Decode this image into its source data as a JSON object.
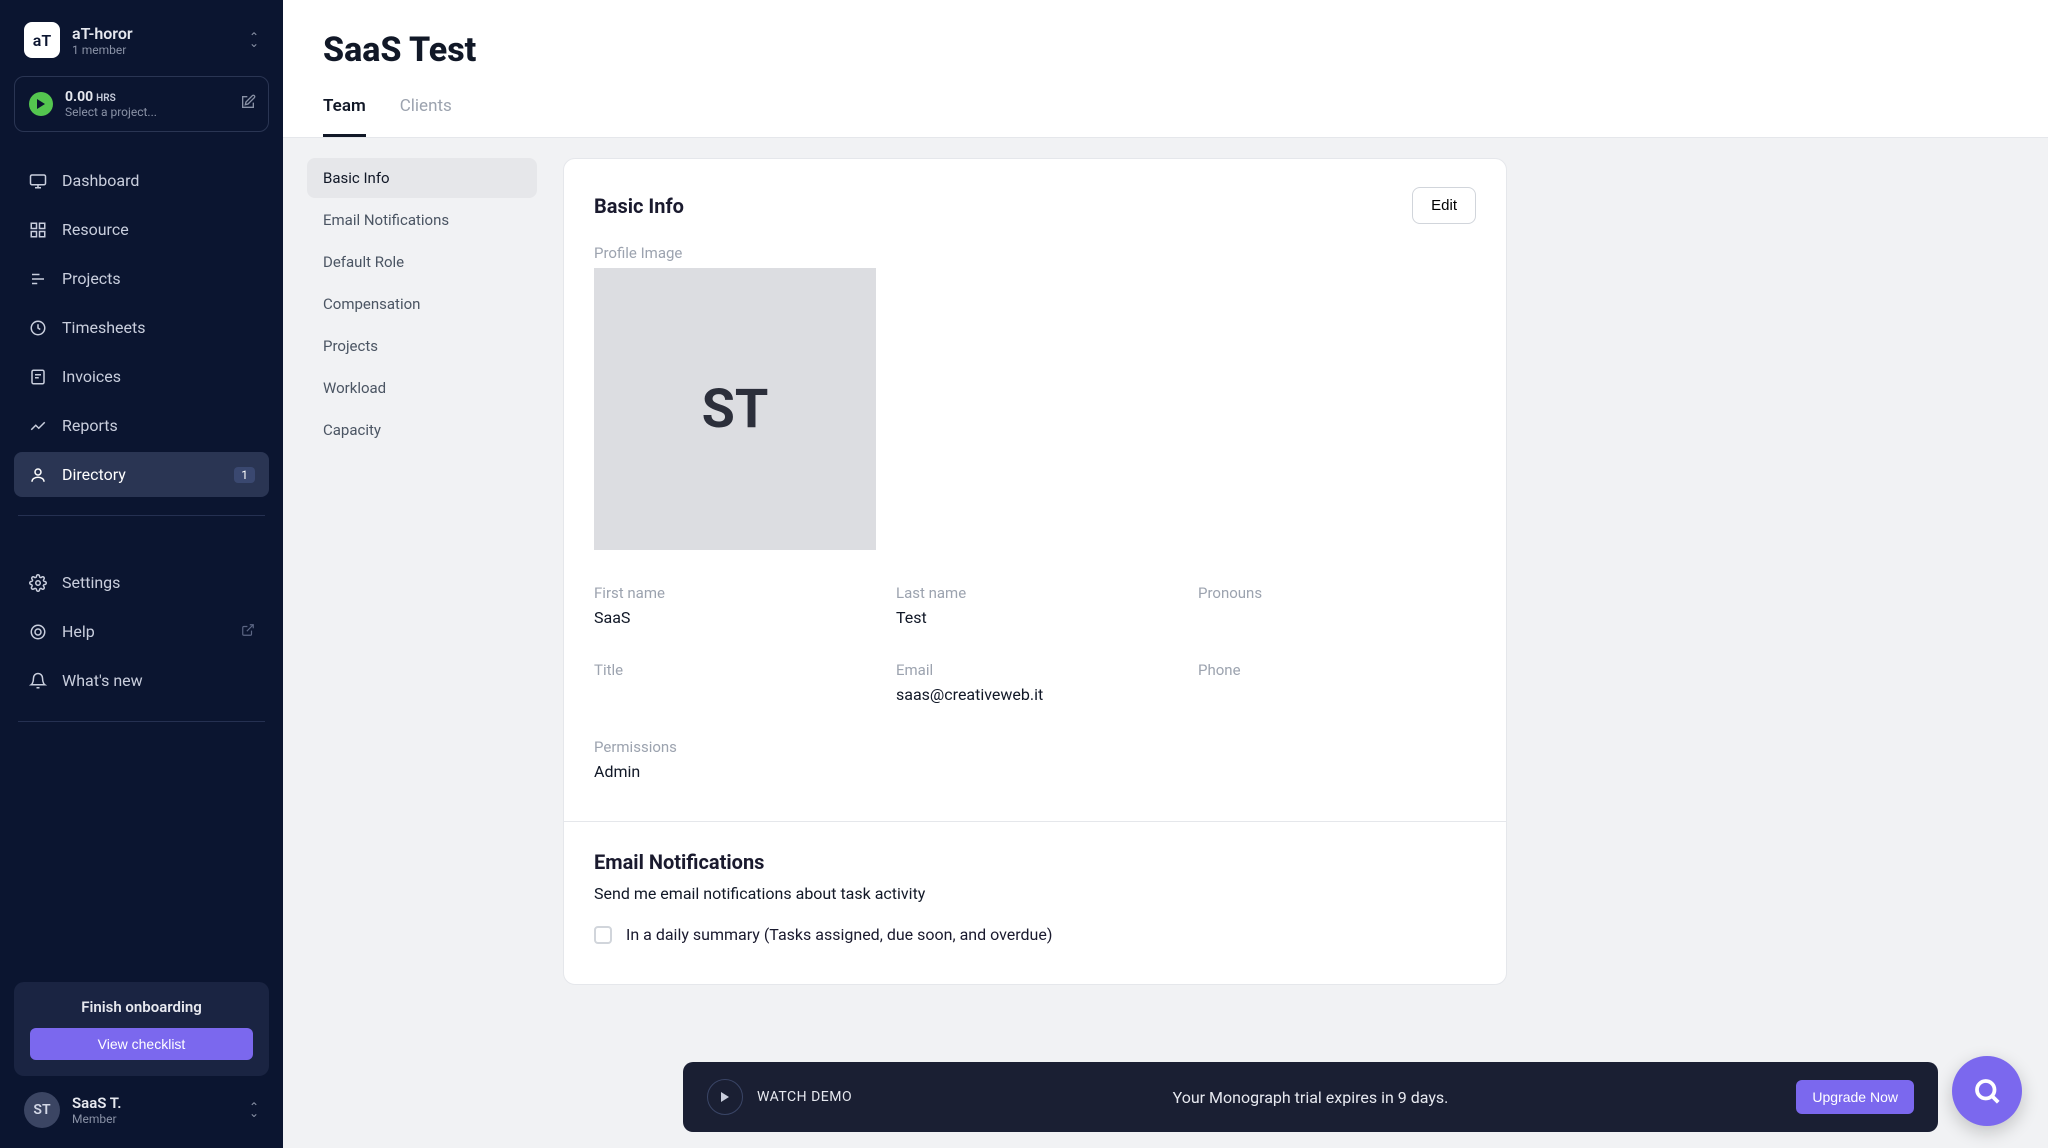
{
  "workspace": {
    "badge": "aT",
    "name": "aT-horor",
    "members": "1 member"
  },
  "timer": {
    "value": "0.00",
    "unit": "HRS",
    "subtitle": "Select a project..."
  },
  "nav": [
    {
      "label": "Dashboard"
    },
    {
      "label": "Resource"
    },
    {
      "label": "Projects"
    },
    {
      "label": "Timesheets"
    },
    {
      "label": "Invoices"
    },
    {
      "label": "Reports"
    },
    {
      "label": "Directory",
      "badge": "1",
      "active": true
    }
  ],
  "nav2": [
    {
      "label": "Settings"
    },
    {
      "label": "Help",
      "external": true
    },
    {
      "label": "What's new"
    }
  ],
  "onboarding": {
    "title": "Finish onboarding",
    "button": "View checklist"
  },
  "user": {
    "initials": "ST",
    "name": "SaaS T.",
    "role": "Member"
  },
  "header": {
    "title": "SaaS Test"
  },
  "tabs": [
    {
      "label": "Team",
      "active": true
    },
    {
      "label": "Clients"
    }
  ],
  "subnav": [
    {
      "label": "Basic Info",
      "active": true
    },
    {
      "label": "Email Notifications"
    },
    {
      "label": "Default Role"
    },
    {
      "label": "Compensation"
    },
    {
      "label": "Projects"
    },
    {
      "label": "Workload"
    },
    {
      "label": "Capacity"
    }
  ],
  "basic": {
    "section_title": "Basic Info",
    "edit": "Edit",
    "profile_label": "Profile Image",
    "profile_initials": "ST",
    "fields": {
      "first_label": "First name",
      "first_value": "SaaS",
      "last_label": "Last name",
      "last_value": "Test",
      "pronouns_label": "Pronouns",
      "pronouns_value": "",
      "title_label": "Title",
      "title_value": "",
      "email_label": "Email",
      "email_value": "saas@creativeweb.it",
      "phone_label": "Phone",
      "phone_value": "",
      "permissions_label": "Permissions",
      "permissions_value": "Admin"
    }
  },
  "email_notifications": {
    "title": "Email Notifications",
    "subtitle": "Send me email notifications about task activity",
    "option1": "In a daily summary (Tasks assigned, due soon, and overdue)"
  },
  "trial": {
    "demo": "WATCH DEMO",
    "message": "Your Monograph trial expires in 9 days.",
    "upgrade": "Upgrade Now"
  }
}
